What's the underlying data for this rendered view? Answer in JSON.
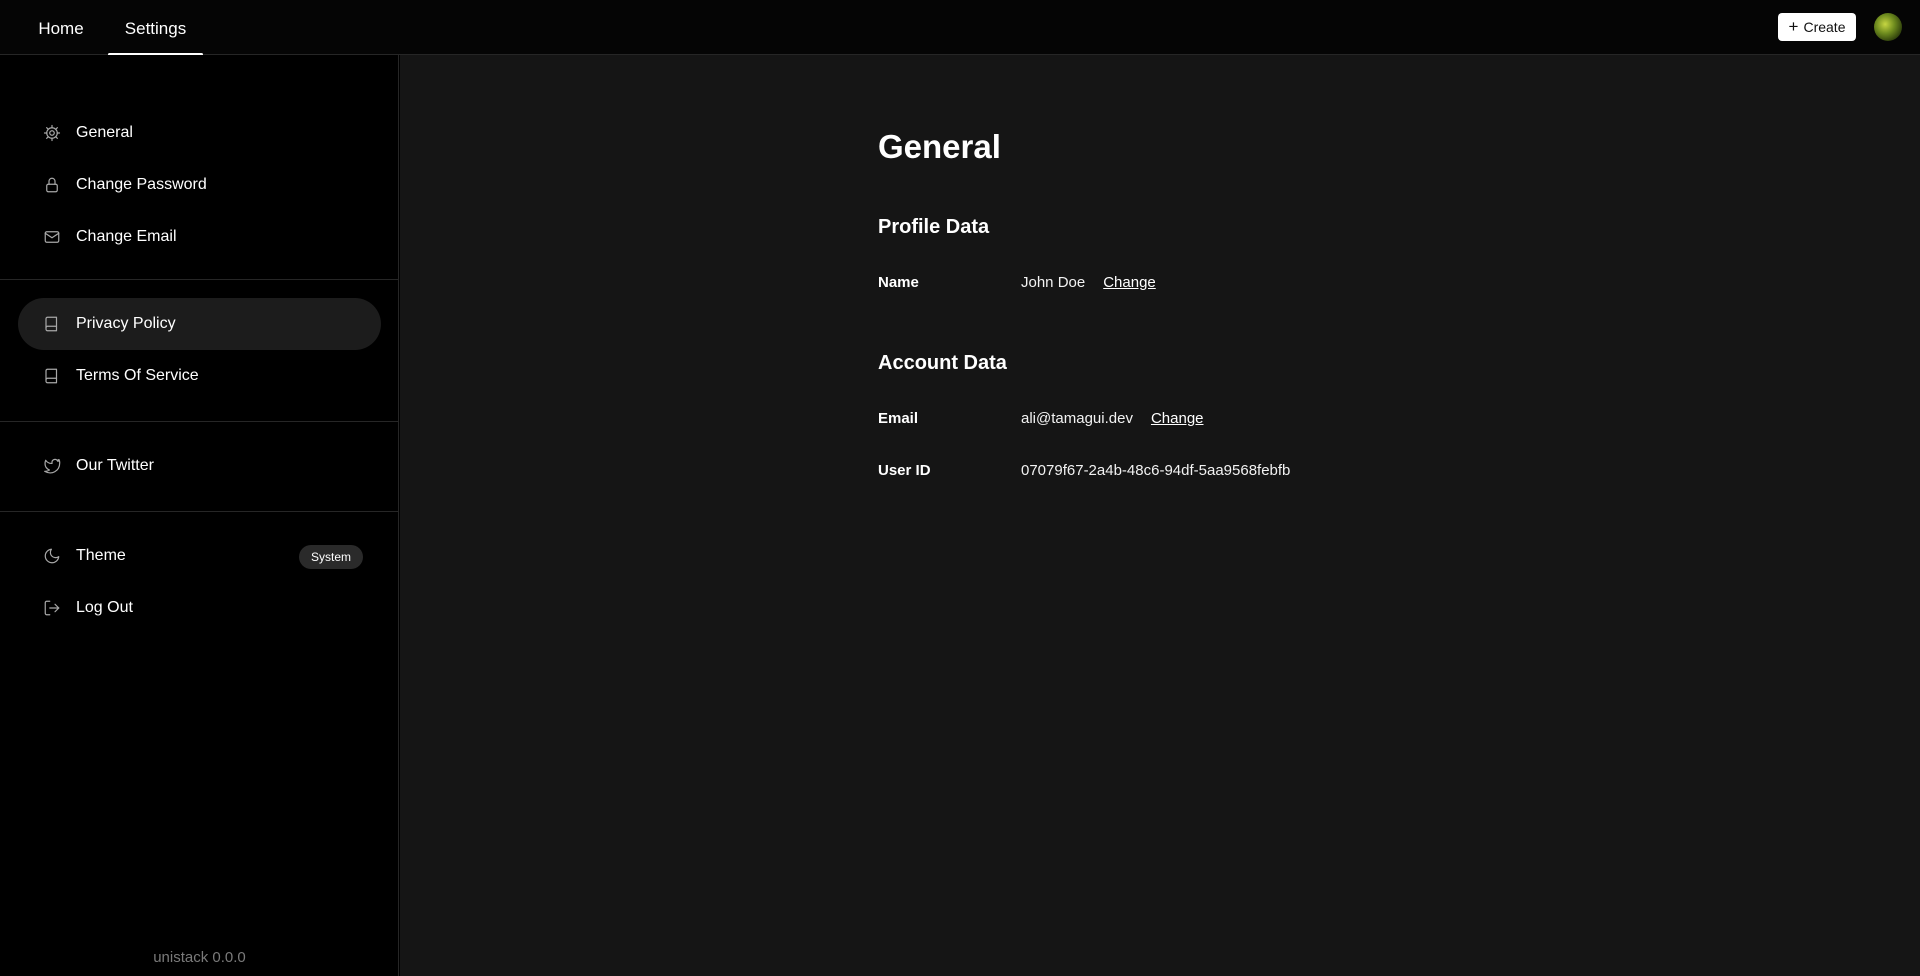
{
  "topbar": {
    "tabs": [
      {
        "label": "Home"
      },
      {
        "label": "Settings",
        "active": true
      }
    ],
    "create_label": "Create",
    "create_icon": "plus-icon",
    "avatar_icon": "user-avatar"
  },
  "sidebar": {
    "groups": [
      [
        {
          "label": "General",
          "icon": "gear-icon"
        },
        {
          "label": "Change Password",
          "icon": "lock-icon"
        },
        {
          "label": "Change Email",
          "icon": "mail-icon"
        }
      ],
      [
        {
          "label": "Privacy Policy",
          "icon": "book-icon",
          "active": true
        },
        {
          "label": "Terms Of Service",
          "icon": "book-icon"
        }
      ],
      [
        {
          "label": "Our Twitter",
          "icon": "twitter-icon"
        }
      ],
      [
        {
          "label": "Theme",
          "icon": "moon-icon",
          "badge": "System"
        },
        {
          "label": "Log Out",
          "icon": "logout-icon"
        }
      ]
    ],
    "version": "unistack 0.0.0"
  },
  "main": {
    "title": "General",
    "profile": {
      "heading": "Profile Data",
      "name_label": "Name",
      "name_value": "John Doe",
      "name_action": "Change"
    },
    "account": {
      "heading": "Account Data",
      "email_label": "Email",
      "email_value": "ali@tamagui.dev",
      "email_action": "Change",
      "userid_label": "User ID",
      "userid_value": "07079f67-2a4b-48c6-94df-5aa9568febfb"
    }
  },
  "colors": {
    "background": "#000000",
    "main_background": "#151515",
    "active_item": "#1c1c1c",
    "divider": "#262626",
    "muted_text": "#7a7a7a"
  }
}
